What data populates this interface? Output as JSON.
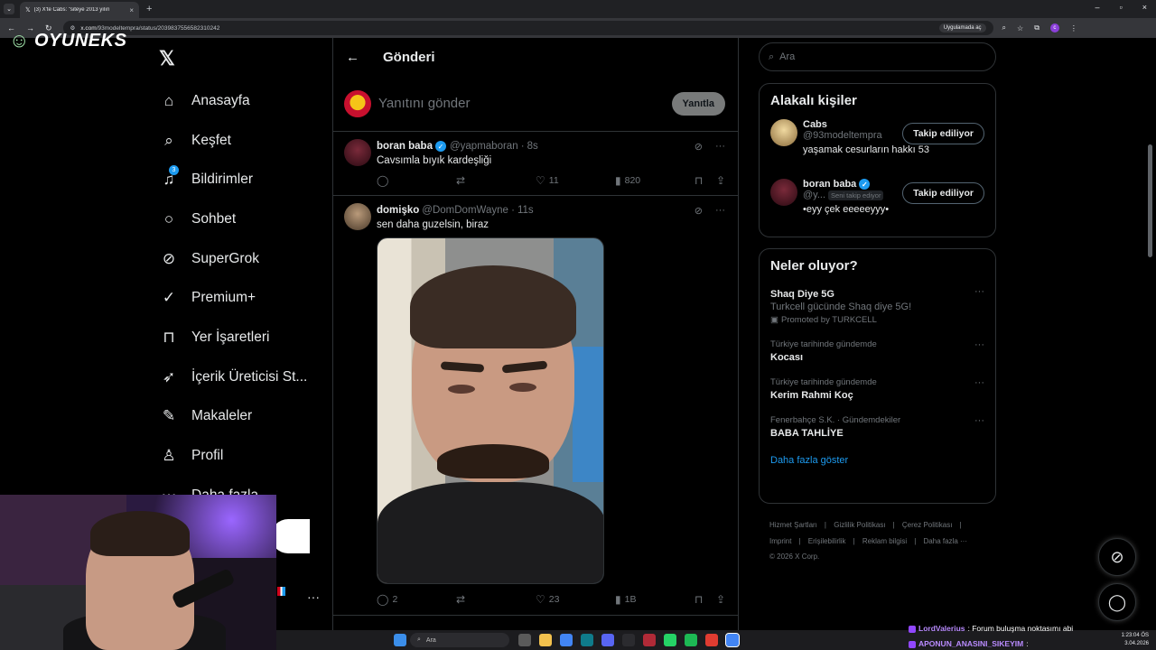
{
  "browser": {
    "tab_title": "(3) X'te Cabs: \"siteye 2013 yılın",
    "url_host": "x.com",
    "url_path": "/93modeltempra/status/2039837556582310242",
    "open_app_label": "Uygulamada aç",
    "profile_letter": "c"
  },
  "overlay": {
    "brand": "OYUNEKS"
  },
  "nav": {
    "items": [
      {
        "label": "Anasayfa",
        "icon": "home-icon"
      },
      {
        "label": "Keşfet",
        "icon": "search-icon"
      },
      {
        "label": "Bildirimler",
        "icon": "bell-icon",
        "badge": "3"
      },
      {
        "label": "Sohbet",
        "icon": "chat-icon"
      },
      {
        "label": "SuperGrok",
        "icon": "grok-icon"
      },
      {
        "label": "Premium+",
        "icon": "verified-icon"
      },
      {
        "label": "Yer İşaretleri",
        "icon": "bookmark-icon"
      },
      {
        "label": "İçerik Üreticisi St...",
        "icon": "rocket-icon"
      },
      {
        "label": "Makaleler",
        "icon": "article-icon"
      },
      {
        "label": "Profil",
        "icon": "profile-icon"
      },
      {
        "label": "Daha fazla",
        "icon": "more-icon"
      }
    ]
  },
  "main": {
    "title": "Gönderi",
    "reply_placeholder": "Yanıtını gönder",
    "reply_button": "Yanıtla",
    "tweets": [
      {
        "name": "boran baba",
        "handle": "@yapmaboran",
        "time": "8s",
        "text": "Cavsımla bıyık kardeşliği",
        "replies": "",
        "retweets": "",
        "likes": "11",
        "views": "820"
      },
      {
        "name": "domişko",
        "handle": "@DomDomWayne",
        "time": "11s",
        "text": "sen daha guzelsin, biraz",
        "replies": "2",
        "retweets": "",
        "likes": "23",
        "views": "1B"
      }
    ]
  },
  "right": {
    "search_placeholder": "Ara",
    "related_title": "Alakalı kişiler",
    "people": [
      {
        "name": "Cabs",
        "handle": "@93modeltempra",
        "bio": "yaşamak cesurların hakkı 53",
        "button": "Takip ediliyor",
        "follows_you": ""
      },
      {
        "name": "boran baba",
        "handle": "@y...",
        "bio": "•eyy çek eeeeeyyy•",
        "button": "Takip ediliyor",
        "follows_you": "Seni takip ediyor"
      }
    ],
    "trends_title": "Neler oluyor?",
    "trends": [
      {
        "category": "",
        "name": "Shaq Diye 5G",
        "desc": "Turkcell gücünde Shaq diye 5G!",
        "promo": "Promoted by TURKCELL"
      },
      {
        "category": "Türkiye tarihinde gündemde",
        "name": "Kocası",
        "desc": "",
        "promo": ""
      },
      {
        "category": "Türkiye tarihinde gündemde",
        "name": "Kerim Rahmi Koç",
        "desc": "",
        "promo": ""
      },
      {
        "category": "Fenerbahçe S.K. · Gündemdekiler",
        "name": "BABA TAHLİYE",
        "desc": "",
        "promo": ""
      }
    ],
    "show_more": "Daha fazla göster",
    "footer": [
      "Hizmet Şartları",
      "Gizlilik Politikası",
      "Çerez Politikası",
      "Imprint",
      "Erişilebilirlik",
      "Reklam bilgisi",
      "Daha fazla ···",
      "© 2026 X Corp."
    ]
  },
  "taskbar": {
    "search": "Ara",
    "time": "1:23:04 ÖS",
    "date": "3.04.2026"
  },
  "chat": [
    {
      "user": "LordValerius",
      "msg": ": Forum buluşma noktasımı abi"
    },
    {
      "user": "APONUN_ANASINI_SIKEYIM",
      "msg": ":"
    }
  ],
  "colors": {
    "accent": "#1d9bf0",
    "bg": "#000000",
    "border": "#2f3336",
    "muted": "#71767b"
  }
}
